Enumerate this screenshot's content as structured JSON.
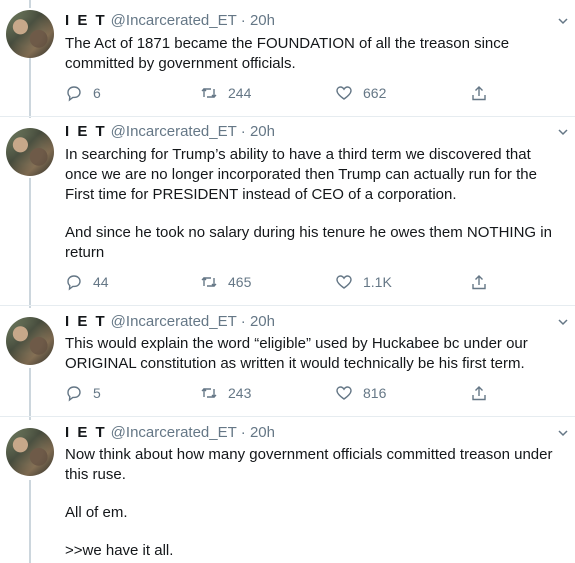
{
  "tweets": [
    {
      "name": "I E T",
      "handle": "@Incarcerated_ET",
      "time": "· 20h",
      "lines": [
        "The Act of 1871 became the FOUNDATION of all the treason since committed by government officials."
      ],
      "reply_count": "6",
      "retweet_count": "244",
      "like_count": "662"
    },
    {
      "name": "I E T",
      "handle": "@Incarcerated_ET",
      "time": "· 20h",
      "lines": [
        "In searching for Trump’s ability to have a third term we discovered that once we are no longer incorporated then Trump can actually run for the First time for PRESIDENT instead of CEO of a corporation.",
        "And since he took no salary during his tenure he owes them NOTHING in return"
      ],
      "reply_count": "44",
      "retweet_count": "465",
      "like_count": "1.1K"
    },
    {
      "name": "I E T",
      "handle": "@Incarcerated_ET",
      "time": "· 20h",
      "lines": [
        "This would explain the word “eligible” used by Huckabee bc under our ORIGINAL constitution as written it would technically be his first term."
      ],
      "reply_count": "5",
      "retweet_count": "243",
      "like_count": "816"
    },
    {
      "name": "I E T",
      "handle": "@Incarcerated_ET",
      "time": "· 20h",
      "lines": [
        "Now think about how many government officials committed treason under this ruse.",
        "All of em.",
        ">>we have it all."
      ]
    }
  ],
  "icons": {
    "reply": "reply-icon",
    "retweet": "retweet-icon",
    "like": "heart-icon",
    "share": "share-icon",
    "menu": "chevron-down-icon"
  },
  "colors": {
    "muted": "#657786",
    "text": "#14171a",
    "thread_line": "#ccd6dd",
    "divider": "#e6ecf0"
  }
}
